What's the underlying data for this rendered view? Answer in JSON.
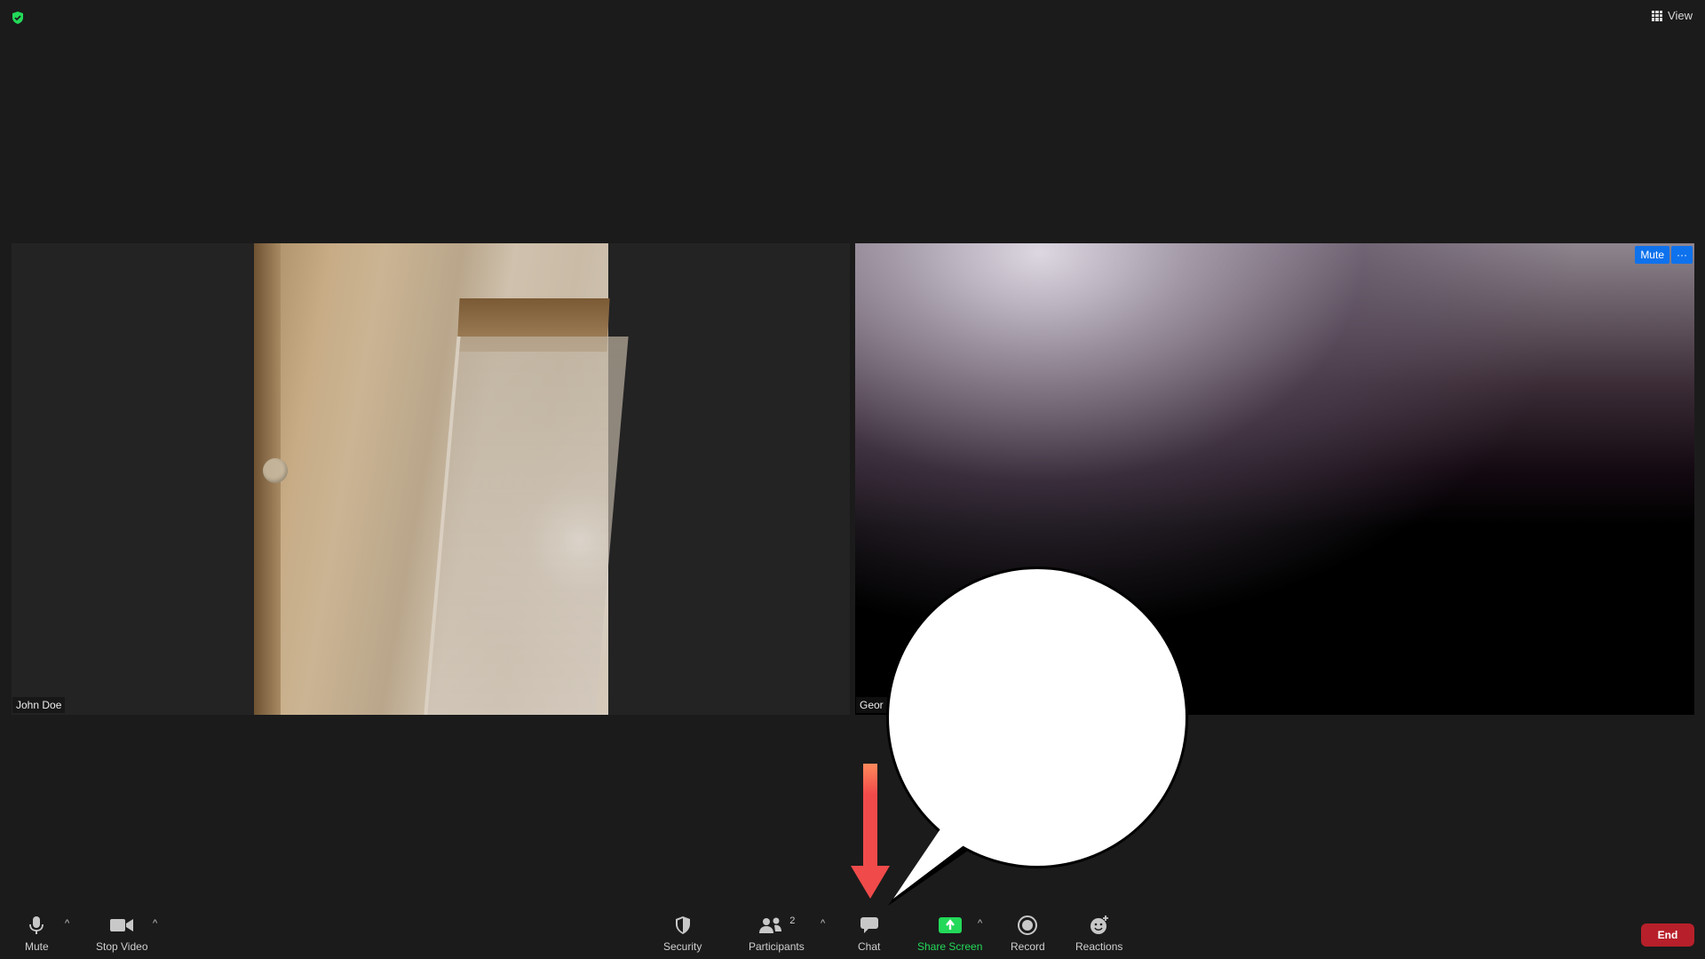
{
  "top_bar": {
    "view_label": "View",
    "security_icon": "shield-check-icon"
  },
  "tiles": [
    {
      "name": "John Doe"
    },
    {
      "name": "Geor",
      "overlay": {
        "mute_label": "Mute",
        "more_label": "···"
      }
    }
  ],
  "toolbar": {
    "mute_label": "Mute",
    "stop_video_label": "Stop Video",
    "security_label": "Security",
    "participants_label": "Participants",
    "participants_count": "2",
    "chat_label": "Chat",
    "share_screen_label": "Share Screen",
    "record_label": "Record",
    "reactions_label": "Reactions",
    "end_label": "End",
    "caret_glyph": "^"
  },
  "colors": {
    "background": "#1b1b1b",
    "accent_blue": "#0e72ed",
    "share_green": "#23d959",
    "end_red": "#b7202a",
    "arrow_red": "#f14a4a"
  }
}
